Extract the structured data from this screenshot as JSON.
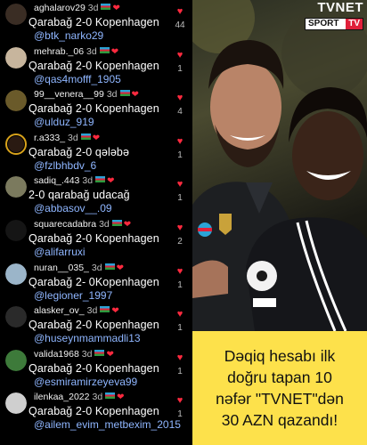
{
  "logo": {
    "brand": "TVNET",
    "sport_left": "SPORT",
    "sport_right": "TV"
  },
  "promo": {
    "lines": [
      "Dəqiq hesabı ilk",
      "doğru tapan 10",
      "nəfər \"TVNET\"dən",
      "30 AZN qazandı!"
    ]
  },
  "comments": [
    {
      "username": "aghalarov29",
      "time": "3d",
      "text": "Qarabağ 2-0 Kopenhagen",
      "mention": "@btk_narko29",
      "likes": "44",
      "avatar_color": "#3a2d24"
    },
    {
      "username": "mehrab._06",
      "time": "3d",
      "text": "Qarabağ 2-0 Kopenhagen",
      "mention": "@qas4mofff_1905",
      "likes": "1",
      "avatar_color": "#c7b59d"
    },
    {
      "username": "99__venera__99",
      "time": "3d",
      "text": "Qarabağ 2-0 Kopenhagen",
      "mention": "@ulduz_919",
      "likes": "4",
      "avatar_color": "#6a5a2a"
    },
    {
      "username": "r.a333_",
      "time": "3d",
      "text": "Qarabağ 2-0 qələbə",
      "mention": "@fzlbhbdv_6",
      "likes": "1",
      "avatar_color": "#2a1a12"
    },
    {
      "username": "sadiq_.443",
      "time": "3d",
      "text": "2-0 qarabağ udacağ",
      "mention": "@abbasov__.09",
      "likes": "1",
      "avatar_color": "#7b7a5e"
    },
    {
      "username": "squarecadabra",
      "time": "3d",
      "text": "Qarabağ 2-0 Kopenhagen",
      "mention": "@alifarruxi",
      "likes": "2",
      "avatar_color": "#151515"
    },
    {
      "username": "nuran__035_",
      "time": "3d",
      "text": "Qarabağ 2- 0Kopenhagen",
      "mention": "@legioner_1997",
      "likes": "1",
      "avatar_color": "#9bb5c9"
    },
    {
      "username": "alasker_ov_",
      "time": "3d",
      "text": "Qarabağ 2-0 Kopenhagen",
      "mention": "@huseynmammadli13",
      "likes": "1",
      "avatar_color": "#2a2a2a"
    },
    {
      "username": "valida1968",
      "time": "3d",
      "text": "Qarabağ 2-0 Kopenhagen",
      "mention": "@esmiramirzeyeva99",
      "likes": "1",
      "avatar_color": "#3d7a3a"
    },
    {
      "username": "ilenkaa_2022",
      "time": "3d",
      "text": "Qarabağ 2-0 Kopenhagen",
      "mention": "@ailem_evim_metbexim_2015",
      "likes": "1",
      "avatar_color": "#cfcfcf"
    }
  ],
  "colors": {
    "heart": "#ff2a3f",
    "mention": "#8fb6ff",
    "promo_bg": "#fde14b"
  }
}
